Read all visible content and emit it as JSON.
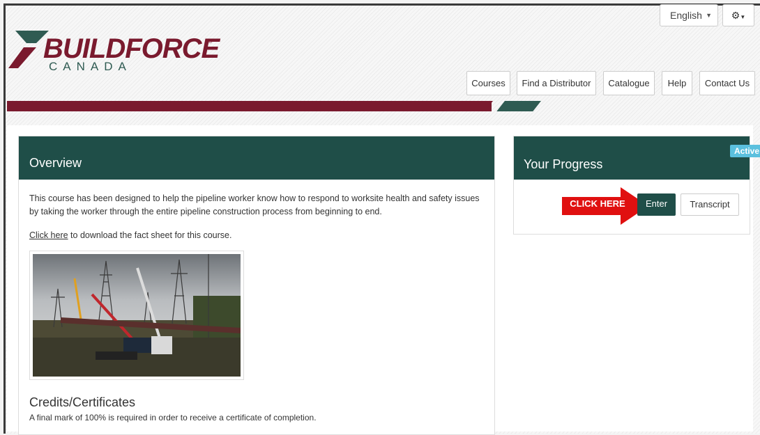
{
  "header": {
    "language": "English",
    "logo": {
      "word": "BUILDFORCE",
      "sub": "CANADA",
      "reg": "®"
    },
    "nav": [
      {
        "label": "Courses"
      },
      {
        "label": "Find a Distributor"
      },
      {
        "label": "Catalogue"
      },
      {
        "label": "Help"
      },
      {
        "label": "Contact Us"
      }
    ]
  },
  "overview": {
    "title": "Overview",
    "description": "This course has been designed to help the pipeline worker know how to respond to worksite health and safety issues by taking the worker through the entire pipeline construction process from beginning to end.",
    "fact_link": "Click here",
    "fact_text": " to download the fact sheet for this course.",
    "credits_title": "Credits/Certificates",
    "credits_text": "A final mark of 100% is required in order to receive a certificate of completion."
  },
  "progress": {
    "title": "Your Progress",
    "status": "Active",
    "callout": "CLICK HERE",
    "enter": "Enter",
    "transcript": "Transcript"
  },
  "colors": {
    "brand_red": "#7a1a2e",
    "brand_green": "#1f4e48",
    "badge": "#5bc0de",
    "callout": "#e01010"
  },
  "icons": [
    "gear-icon",
    "chevron-down-icon",
    "arrow-icon"
  ]
}
